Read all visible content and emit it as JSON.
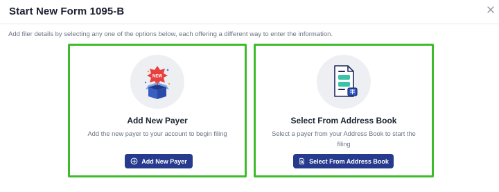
{
  "dialog": {
    "title": "Start New Form 1095-B",
    "subtitle": "Add filer details by selecting any one of the options below, each offering a different way to enter the information."
  },
  "options": [
    {
      "title": "Add New Payer",
      "description": "Add the new payer to your account to begin filing",
      "button_label": "Add New Payer",
      "icon": "new-box-icon",
      "button_icon": "plus-circle-icon",
      "badge_text": "NEW"
    },
    {
      "title": "Select From Address Book",
      "description": "Select a payer from your Address Book to start the filing",
      "button_label": "Select From Address Book",
      "icon": "address-book-document-icon",
      "button_icon": "document-search-icon"
    }
  ],
  "colors": {
    "highlight_border": "#3dbb2a",
    "button_bg": "#263a8e",
    "text_muted": "#6b7382"
  }
}
